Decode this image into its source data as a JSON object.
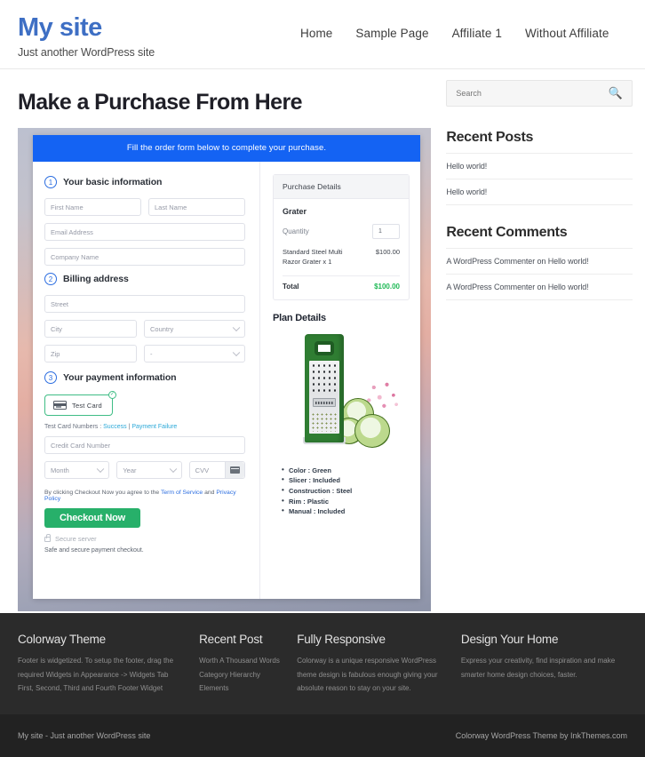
{
  "header": {
    "brand_title": "My site",
    "tagline": "Just another WordPress site",
    "nav": [
      {
        "label": "Home"
      },
      {
        "label": "Sample Page"
      },
      {
        "label": "Affiliate 1"
      },
      {
        "label": "Without Affiliate"
      }
    ]
  },
  "main": {
    "page_title": "Make a Purchase From Here",
    "order_form": {
      "banner": "Fill the order form below to complete your purchase.",
      "steps": [
        {
          "num": "1",
          "label": "Your basic information"
        },
        {
          "num": "2",
          "label": "Billing address"
        },
        {
          "num": "3",
          "label": "Your payment information"
        }
      ],
      "fields": {
        "first_name": "First Name",
        "last_name": "Last Name",
        "email": "Email Address",
        "company": "Company Name",
        "street": "Street",
        "city": "City",
        "country": "Country",
        "zip": "Zip",
        "state": "-",
        "card_number": "Credit Card Number",
        "month": "Month",
        "year": "Year",
        "cvv": "CVV"
      },
      "test_card": {
        "label": "Test  Card",
        "note_prefix": "Test Card Numbers : ",
        "success": "Success",
        "separator": " | ",
        "failure": "Payment Failure"
      },
      "terms": {
        "prefix": "By clicking Checkout Now you agree to the ",
        "tos": "Term of Service",
        "and": " and ",
        "privacy": "Privacy Policy"
      },
      "checkout_label": "Checkout Now",
      "secure_server": "Secure server",
      "safe_text": "Safe and secure payment checkout."
    },
    "purchase_details": {
      "heading": "Purchase Details",
      "product": "Grater",
      "quantity_label": "Quantity",
      "quantity_value": "1",
      "line_item": "Standard Steel Multi Razor Grater x 1",
      "line_amount": "$100.00",
      "total_label": "Total",
      "total_amount": "$100.00",
      "total_color": "#1db954"
    },
    "plan_details": {
      "heading": "Plan Details",
      "specs": [
        "Color : Green",
        "Slicer : Included",
        "Construction : Steel",
        "Rim : Plastic",
        "Manual : Included"
      ]
    }
  },
  "sidebar": {
    "search_placeholder": "Search",
    "search_icon": "search-icon",
    "recent_posts": {
      "title": "Recent Posts",
      "items": [
        "Hello world!",
        "Hello world!"
      ]
    },
    "recent_comments": {
      "title": "Recent Comments",
      "items": [
        "A WordPress Commenter on Hello world!",
        "A WordPress Commenter on Hello world!"
      ]
    }
  },
  "footer": {
    "columns": [
      {
        "title": "Colorway Theme",
        "text": "Footer is widgetized. To setup the footer, drag the required Widgets in Appearance -> Widgets Tab First, Second, Third and Fourth Footer Widget"
      },
      {
        "title": "Recent Post",
        "items": [
          "Worth A Thousand Words",
          "Category Hierarchy",
          "Elements"
        ]
      },
      {
        "title": "Fully Responsive",
        "text": "Colorway is a unique responsive WordPress theme design is fabulous enough giving your absolute reason to stay on your site."
      },
      {
        "title": "Design Your Home",
        "text": "Express your creativity, find inspiration and make smarter home design choices, faster."
      }
    ],
    "bottom_left": "My site - Just another WordPress site",
    "bottom_right": "Colorway WordPress Theme by InkThemes.com"
  },
  "colors": {
    "brand": "#3e6fc4",
    "banner": "#1463f3",
    "checkout": "#27b06a",
    "accent_link": "#2aa8d8",
    "footer_bg": "#2b2b2b"
  }
}
